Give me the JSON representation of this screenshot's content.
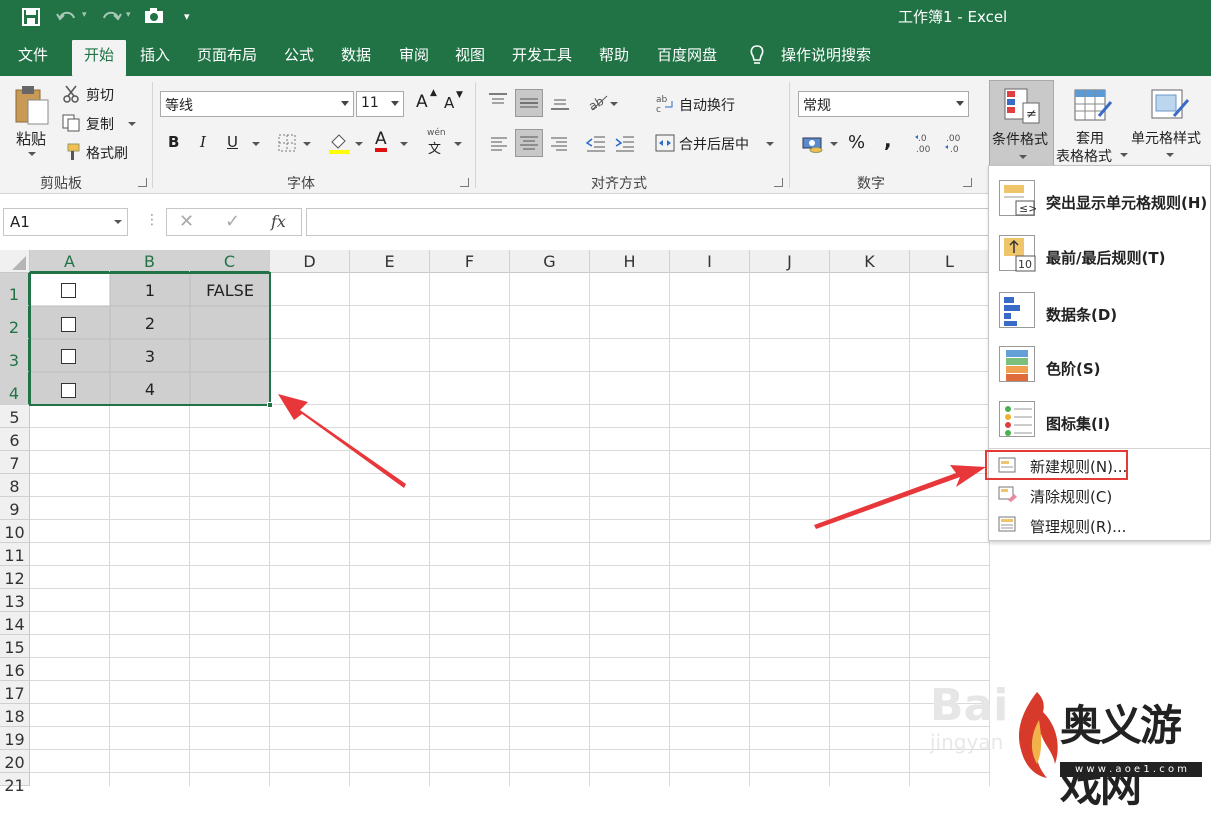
{
  "window": {
    "title": "工作簿1  -  Excel"
  },
  "menu": {
    "tabs": [
      "文件",
      "开始",
      "插入",
      "页面布局",
      "公式",
      "数据",
      "审阅",
      "视图",
      "开发工具",
      "帮助",
      "百度网盘"
    ],
    "tell_me": "操作说明搜索"
  },
  "ribbon": {
    "clipboard": {
      "paste": "粘贴",
      "cut": "剪切",
      "copy": "复制",
      "format_painter": "格式刷",
      "label": "剪贴板"
    },
    "font": {
      "name": "等线",
      "size": "11",
      "bold": "B",
      "italic": "I",
      "underline": "U",
      "grow": "A",
      "shrink": "A",
      "font_color": "A",
      "phonetic_top": "wén",
      "phonetic": "文",
      "label": "字体"
    },
    "alignment": {
      "wrap_text": "自动换行",
      "merge_center": "合并后居中",
      "label": "对齐方式"
    },
    "number": {
      "format": "常规",
      "percent": "%",
      "comma": ",",
      "inc_decimal": "←.0\n.00",
      "dec_decimal": ".00\n→.0",
      "label": "数字"
    },
    "styles": {
      "conditional_format": "条件格式",
      "table_format_1": "套用",
      "table_format_2": "表格格式",
      "cell_styles": "单元格样式"
    }
  },
  "formula_bar": {
    "name_box": "A1",
    "fx": "fx",
    "value": ""
  },
  "sheet": {
    "columns": [
      "A",
      "B",
      "C",
      "D",
      "E",
      "F",
      "G",
      "H",
      "I",
      "J",
      "K",
      "L"
    ],
    "rows": [
      "1",
      "2",
      "3",
      "4",
      "5",
      "6",
      "7",
      "8",
      "9",
      "10",
      "11",
      "12",
      "13",
      "14",
      "15",
      "16",
      "17",
      "18",
      "19",
      "20",
      "21"
    ],
    "cells": {
      "B1": "1",
      "B2": "2",
      "B3": "3",
      "B4": "4",
      "C1": "FALSE"
    },
    "checkboxes": [
      "A1",
      "A2",
      "A3",
      "A4"
    ]
  },
  "cf_menu": {
    "items": [
      "突出显示单元格规则(H)",
      "最前/最后规则(T)",
      "数据条(D)",
      "色阶(S)",
      "图标集(I)"
    ],
    "commands": [
      "新建规则(N)...",
      "清除规则(C)",
      "管理规则(R)..."
    ]
  },
  "watermark": {
    "baidu": "Bai",
    "jingyan": "jingyan",
    "brand": "奥义游戏网",
    "url": "w w w . a o e 1 . c o m"
  },
  "colors": {
    "excel_green": "#217346",
    "highlight_red": "#e53935",
    "arrow_red": "#e8373a"
  }
}
